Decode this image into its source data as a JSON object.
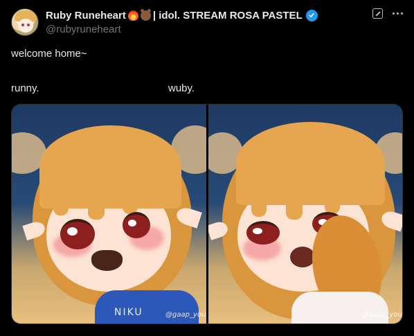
{
  "tweet": {
    "author": {
      "display_name": "Ruby Runeheart",
      "name_suffix": "| idol. STREAM ROSA PASTEL",
      "handle": "@rubyruneheart",
      "emoji": [
        "fire-heart-icon",
        "bear-icon"
      ],
      "verified": true
    },
    "text": {
      "line1": "welcome home~",
      "caption_left": "runny.",
      "caption_right": "wuby."
    },
    "media": {
      "panels": [
        {
          "shirt_text": "NIKU",
          "watermark": "@gaap_you"
        },
        {
          "watermark": "@gaap_you"
        }
      ]
    },
    "actions": {
      "grok_icon": "grok-icon",
      "more_icon": "more-icon"
    }
  },
  "colors": {
    "background": "#000000",
    "text_primary": "#e7e9ea",
    "text_secondary": "#71767b",
    "verified": "#1d9bf0"
  }
}
